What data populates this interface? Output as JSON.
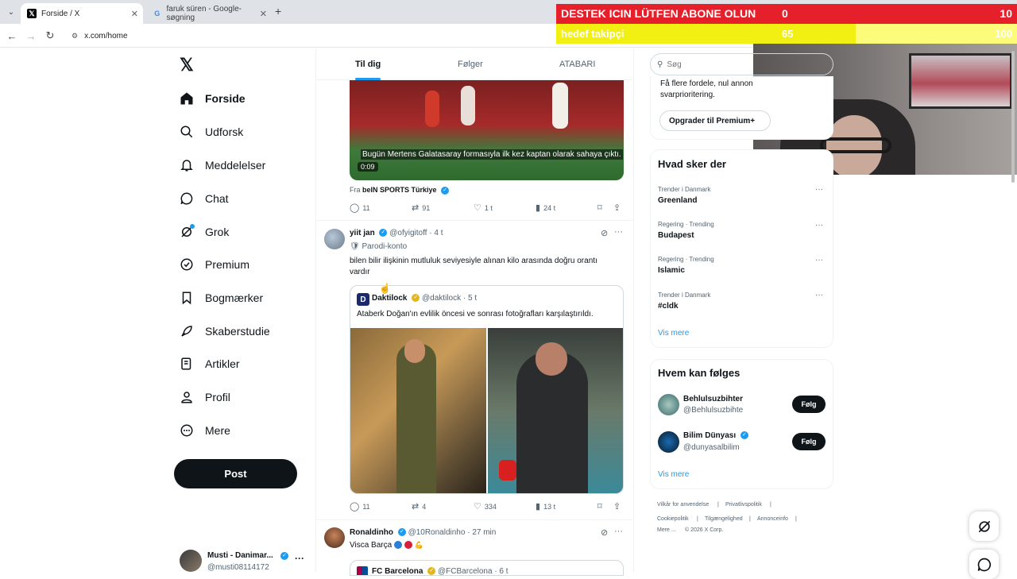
{
  "browser": {
    "tabs": [
      {
        "title": "Forside / X",
        "active": true
      },
      {
        "title": "faruk süren - Google-søgning",
        "active": false
      }
    ],
    "url": "x.com/home"
  },
  "overlay": {
    "goal_label": "DESTEK ICIN LÜTFEN ABONE OLUN",
    "goal_current": "0",
    "goal_target": "10",
    "goal_progress": 0,
    "follower_label": "hedef takipçi",
    "follower_current": "65",
    "follower_target": "100",
    "follower_progress": 0.65,
    "colors": {
      "red": "#e5202b",
      "yellow": "#f2ef12"
    }
  },
  "nav": {
    "items": [
      {
        "label": "Forside",
        "icon": "home-icon",
        "active": true
      },
      {
        "label": "Udforsk",
        "icon": "search-icon"
      },
      {
        "label": "Meddelelser",
        "icon": "bell-icon"
      },
      {
        "label": "Chat",
        "icon": "chat-icon"
      },
      {
        "label": "Grok",
        "icon": "grok-icon"
      },
      {
        "label": "Premium",
        "icon": "premium-icon"
      },
      {
        "label": "Bogmærker",
        "icon": "bookmark-icon"
      },
      {
        "label": "Skaberstudie",
        "icon": "rocket-icon"
      },
      {
        "label": "Artikler",
        "icon": "article-icon"
      },
      {
        "label": "Profil",
        "icon": "person-icon"
      },
      {
        "label": "Mere",
        "icon": "more-circle-icon"
      }
    ],
    "post_label": "Post",
    "account": {
      "name": "Musti - Danimar...",
      "handle": "@musti08114172"
    }
  },
  "feed": {
    "tabs": [
      "Til dig",
      "Følger",
      "ATABARI"
    ],
    "tweet1": {
      "caption": "Bugün Mertens Galatasaray formasıyla ilk kez kaptan olarak sahaya çıktı.",
      "duration": "0:09",
      "source_prefix": "Fra",
      "source": "beIN SPORTS Türkiye",
      "replies": "11",
      "reposts": "91",
      "likes": "1 t",
      "views": "24 t"
    },
    "tweet2": {
      "name": "yiit jan",
      "handle": "@ofyigitoff",
      "time": "· 4 t",
      "badge": "Parodi-konto",
      "text": "bilen bilir ilişkinin mutluluk seviyesiyle alınan kilo arasında doğru orantı vardır",
      "quote": {
        "name": "Daktilock",
        "handle": "@daktilock",
        "time": "· 5 t",
        "text": "Ataberk Doğan'ın evlilik öncesi ve sonrası fotoğrafları karşılaştırıldı."
      },
      "replies": "11",
      "reposts": "4",
      "likes": "334",
      "views": "13 t"
    },
    "tweet3": {
      "name": "Ronaldinho",
      "handle": "@10Ronaldinho",
      "time": "· 27 min",
      "text": "Visca Barça",
      "quote_name": "FC Barcelona",
      "quote_handle": "@FCBarcelona",
      "quote_time": "· 6 t"
    }
  },
  "right": {
    "search_placeholder": "Søg",
    "premium_text": "Få flere fordele, nul annon svarprioritering.",
    "premium_line1": "Få flere fordele, nul annon",
    "premium_line2": "svarprioritering.",
    "premium_button": "Opgrader til Premium+",
    "trends_title": "Hvad sker der",
    "trends": [
      {
        "meta": "Trender i Danmark",
        "name": "Greenland"
      },
      {
        "meta": "Regering · Trending",
        "name": "Budapest"
      },
      {
        "meta": "Regering · Trending",
        "name": "Islamic"
      },
      {
        "meta": "Trender i Danmark",
        "name": "#cldk"
      }
    ],
    "show_more": "Vis mere",
    "follow_title": "Hvem kan følges",
    "suggestions": [
      {
        "name": "Behlulsuzbihter",
        "handle": "@Behlulsuzbihte",
        "button": "Følg"
      },
      {
        "name": "Bilim Dünyası",
        "handle": "@dunyasalbilim",
        "button": "Følg"
      }
    ],
    "show_more_2": "Vis mere",
    "footer": [
      "Vilkår for anvendelse",
      "Privatlivspolitik",
      "Cookiepolitik",
      "Tilgængelighed",
      "Annonceinfo",
      "Mere ...",
      "© 2026 X Corp."
    ]
  }
}
